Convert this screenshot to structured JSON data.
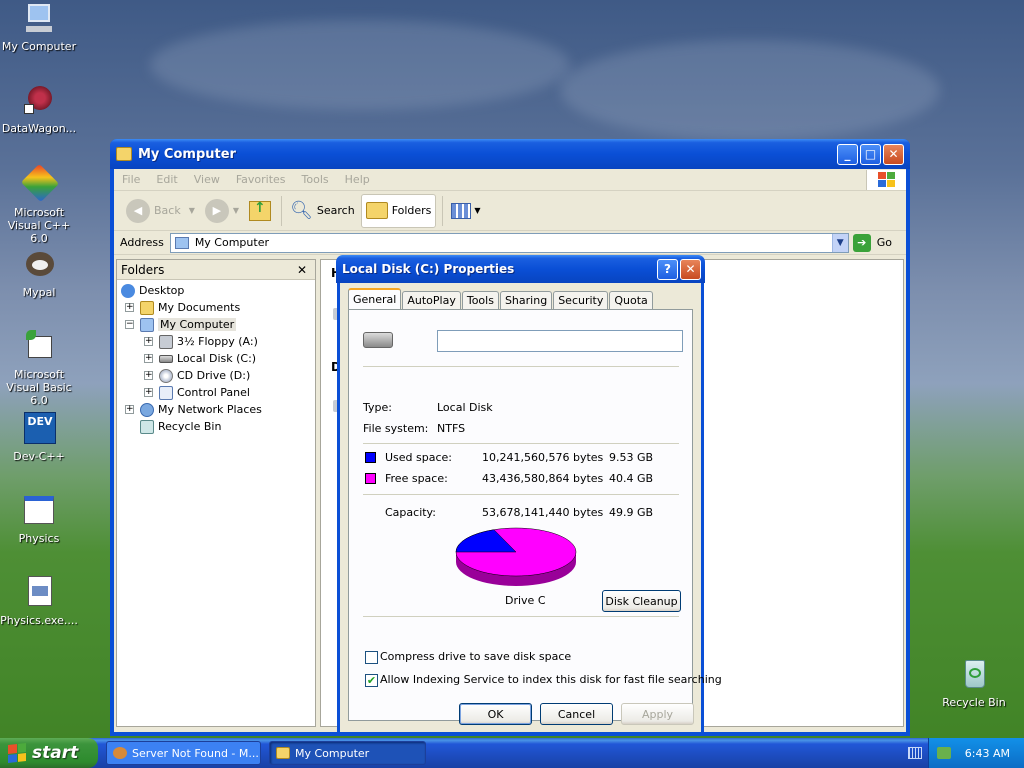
{
  "desktop": {
    "icons": [
      {
        "label": "My Computer"
      },
      {
        "label": "DataWagon..."
      },
      {
        "label": "Microsoft Visual C++ 6.0"
      },
      {
        "label": "Mypal"
      },
      {
        "label": "Microsoft Visual Basic 6.0"
      },
      {
        "label": "Dev-C++"
      },
      {
        "label": "Physics"
      },
      {
        "label": "Physics.exe...."
      },
      {
        "label": "Recycle Bin"
      }
    ]
  },
  "window": {
    "title": "My Computer",
    "menu": [
      "File",
      "Edit",
      "View",
      "Favorites",
      "Tools",
      "Help"
    ],
    "toolbar": {
      "back": "Back",
      "search": "Search",
      "folders": "Folders"
    },
    "address": {
      "label": "Address",
      "value": "My Computer",
      "go": "Go"
    },
    "folders_pane": {
      "title": "Folders",
      "close": "✕",
      "tree": [
        "Desktop",
        "My Documents",
        "My Computer",
        "3½ Floppy (A:)",
        "Local Disk (C:)",
        "CD Drive (D:)",
        "Control Panel",
        "My Network Places",
        "Recycle Bin"
      ]
    },
    "right_pane": {
      "partial_h": "H",
      "partial_d": "D"
    }
  },
  "dialog": {
    "title": "Local Disk (C:) Properties",
    "help": "?",
    "close": "✕",
    "tabs": [
      "General",
      "AutoPlay",
      "Tools",
      "Sharing",
      "Security",
      "Quota"
    ],
    "name_value": "",
    "type_label": "Type:",
    "type_value": "Local Disk",
    "fs_label": "File system:",
    "fs_value": "NTFS",
    "used": {
      "label": "Used space:",
      "bytes": "10,241,560,576 bytes",
      "size": "9.53 GB",
      "color": "#0000ff"
    },
    "free": {
      "label": "Free space:",
      "bytes": "43,436,580,864 bytes",
      "size": "40.4 GB",
      "color": "#ff00ff"
    },
    "capacity": {
      "label": "Capacity:",
      "bytes": "53,678,141,440 bytes",
      "size": "49.9 GB"
    },
    "drive_label": "Drive C",
    "disk_cleanup": "Disk Cleanup",
    "compress": {
      "label": "Compress drive to save disk space",
      "checked": false
    },
    "indexing": {
      "label": "Allow Indexing Service to index this disk for fast file searching",
      "checked": true
    },
    "buttons": {
      "ok": "OK",
      "cancel": "Cancel",
      "apply": "Apply"
    },
    "used_fraction": 0.19
  },
  "taskbar": {
    "start": "start",
    "tasks": [
      "Server Not Found - M...",
      "My Computer"
    ],
    "clock": "6:43 AM"
  }
}
